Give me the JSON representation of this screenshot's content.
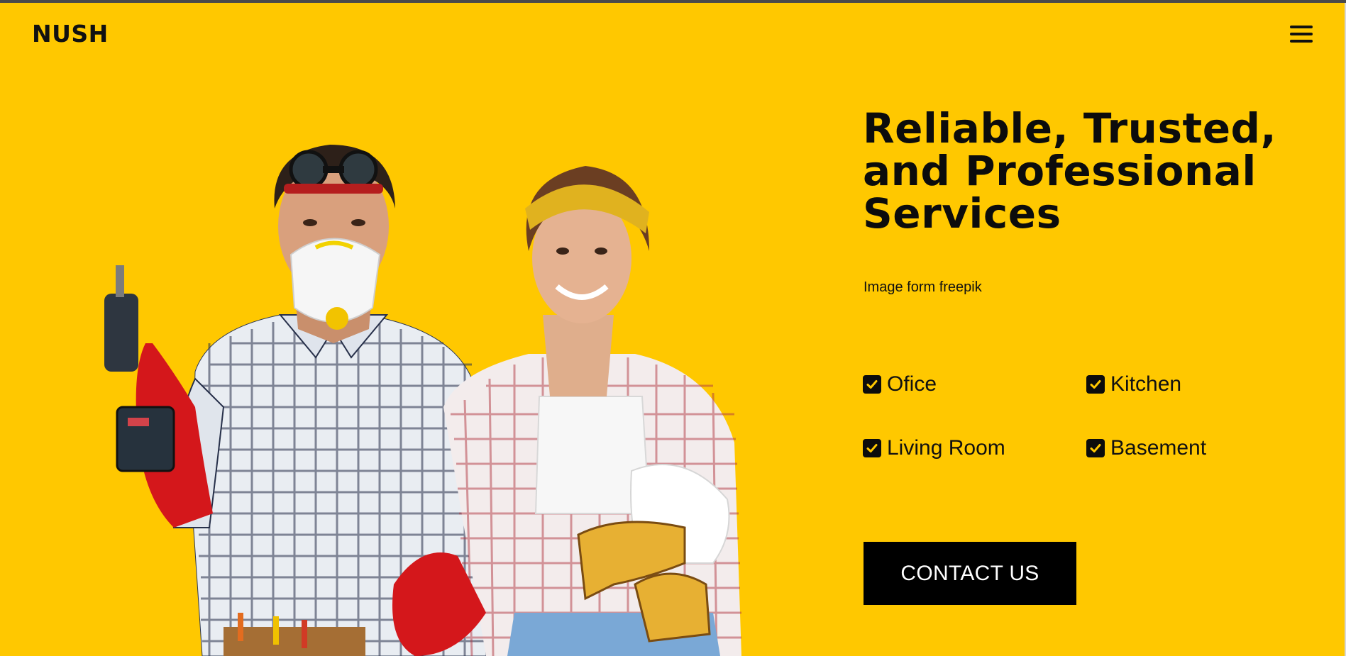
{
  "header": {
    "brand": "NUSH",
    "menu_icon": "hamburger-menu-icon"
  },
  "hero": {
    "headline_line1": "Reliable, Trusted,",
    "headline_line2": "and Professional",
    "headline_line3": "Services",
    "image_credit": "Image form freepik",
    "features": [
      {
        "label": "Ofice",
        "icon": "checkbox-checked-icon"
      },
      {
        "label": "Kitchen",
        "icon": "checkbox-checked-icon"
      },
      {
        "label": "Living Room",
        "icon": "checkbox-checked-icon"
      },
      {
        "label": "Basement",
        "icon": "checkbox-checked-icon"
      }
    ],
    "cta_label": "CONTACT US"
  },
  "colors": {
    "background": "#ffc800",
    "text": "#0c0c0c",
    "button": "#000000",
    "button_text": "#ffffff"
  }
}
